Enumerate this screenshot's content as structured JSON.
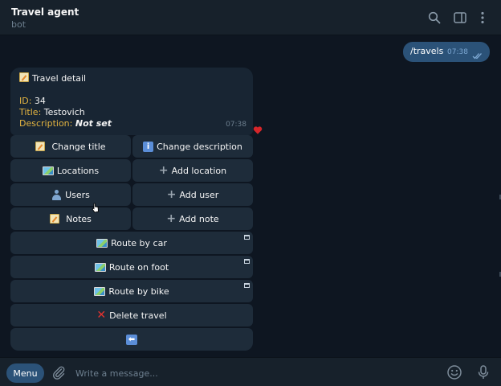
{
  "header": {
    "title": "Travel agent",
    "subtitle": "bot",
    "icons": [
      "search-icon",
      "sidebar-toggle-icon",
      "more-vertical-icon"
    ]
  },
  "outgoing": {
    "text": "/travels",
    "time": "07:38",
    "status": "read"
  },
  "incoming": {
    "heading": "Travel detail",
    "id_label": "ID:",
    "id_value": "34",
    "title_label": "Title:",
    "title_value": "Testovich",
    "description_label": "Description:",
    "description_value": "Not set",
    "time": "07:38",
    "reaction": "heart"
  },
  "keyboard": {
    "change_title": "Change title",
    "change_description": "Change description",
    "locations": "Locations",
    "add_location": "Add location",
    "users": "Users",
    "add_user": "Add user",
    "notes": "Notes",
    "add_note": "Add note",
    "route_by_car": "Route by car",
    "route_on_foot": "Route on foot",
    "route_by_bike": "Route by bike",
    "delete_travel": "Delete travel"
  },
  "composer": {
    "menu_label": "Menu",
    "placeholder": "Write a message...",
    "icons": [
      "paperclip-icon",
      "emoji-icon",
      "microphone-icon"
    ]
  },
  "colors": {
    "background": "#0e1621",
    "header": "#17212b",
    "accent": "#2b5278",
    "key_text": "#e2b340"
  }
}
